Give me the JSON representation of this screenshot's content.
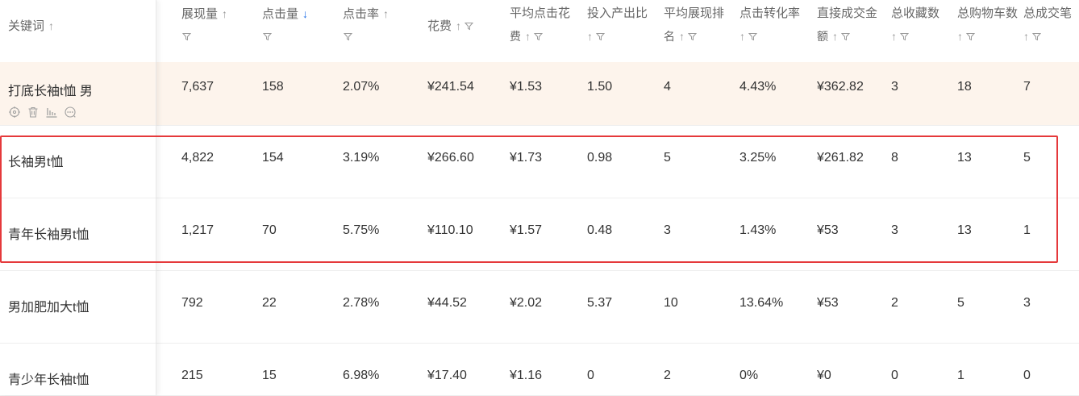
{
  "table": {
    "columns": [
      {
        "key": "keyword",
        "line1": "关键词",
        "line2": "",
        "sort": "↑",
        "filter": false,
        "active": false
      },
      {
        "key": "impressions",
        "line1": "展现量",
        "line2": "",
        "sort": "↑",
        "filter": true,
        "active": false
      },
      {
        "key": "clicks",
        "line1": "点击量",
        "line2": "",
        "sort": "↓",
        "filter": true,
        "active": true
      },
      {
        "key": "ctr",
        "line1": "点击率",
        "line2": "",
        "sort": "↑",
        "filter": true,
        "active": false
      },
      {
        "key": "cost",
        "line1": "花费",
        "line2": "",
        "sort": "↑",
        "filter": true,
        "active": false
      },
      {
        "key": "cpc",
        "line1": "平均点击花",
        "line2": "费",
        "sort": "↑",
        "filter": true,
        "active": false
      },
      {
        "key": "roi",
        "line1": "投入产出比",
        "line2": "",
        "sort": "↑",
        "filter": true,
        "active": false
      },
      {
        "key": "avg_rank",
        "line1": "平均展现排",
        "line2": "名",
        "sort": "↑",
        "filter": true,
        "active": false
      },
      {
        "key": "cvr",
        "line1": "点击转化率",
        "line2": "",
        "sort": "↑",
        "filter": true,
        "active": false
      },
      {
        "key": "gmv",
        "line1": "直接成交金",
        "line2": "额",
        "sort": "↑",
        "filter": true,
        "active": false
      },
      {
        "key": "fav",
        "line1": "总收藏数",
        "line2": "",
        "sort": "↑",
        "filter": true,
        "active": false
      },
      {
        "key": "cart",
        "line1": "总购物车数",
        "line2": "",
        "sort": "↑",
        "filter": true,
        "active": false
      },
      {
        "key": "orders",
        "line1": "总成交笔",
        "line2": "",
        "sort": "↑",
        "filter": true,
        "active": false
      }
    ],
    "rows": [
      {
        "keyword": "打底长袖t恤 男",
        "impressions": "7,637",
        "clicks": "158",
        "ctr": "2.07%",
        "cost": "¥241.54",
        "cpc": "¥1.53",
        "roi": "1.50",
        "avg_rank": "4",
        "cvr": "4.43%",
        "gmv": "¥362.82",
        "fav": "3",
        "cart": "18",
        "orders": "7",
        "highlight": true
      },
      {
        "keyword": "长袖男t恤",
        "impressions": "4,822",
        "clicks": "154",
        "ctr": "3.19%",
        "cost": "¥266.60",
        "cpc": "¥1.73",
        "roi": "0.98",
        "avg_rank": "5",
        "cvr": "3.25%",
        "gmv": "¥261.82",
        "fav": "8",
        "cart": "13",
        "orders": "5",
        "highlight": false
      },
      {
        "keyword": "青年长袖男t恤",
        "impressions": "1,217",
        "clicks": "70",
        "ctr": "5.75%",
        "cost": "¥110.10",
        "cpc": "¥1.57",
        "roi": "0.48",
        "avg_rank": "3",
        "cvr": "1.43%",
        "gmv": "¥53",
        "fav": "3",
        "cart": "13",
        "orders": "1",
        "highlight": false
      },
      {
        "keyword": "男加肥加大t恤",
        "impressions": "792",
        "clicks": "22",
        "ctr": "2.78%",
        "cost": "¥44.52",
        "cpc": "¥2.02",
        "roi": "5.37",
        "avg_rank": "10",
        "cvr": "13.64%",
        "gmv": "¥53",
        "fav": "2",
        "cart": "5",
        "orders": "3",
        "highlight": false
      },
      {
        "keyword": "青少年长袖t恤",
        "impressions": "215",
        "clicks": "15",
        "ctr": "6.98%",
        "cost": "¥17.40",
        "cpc": "¥1.16",
        "roi": "0",
        "avg_rank": "2",
        "cvr": "0%",
        "gmv": "¥0",
        "fav": "0",
        "cart": "1",
        "orders": "0",
        "highlight": false
      }
    ],
    "row_action_icons": [
      "target-icon",
      "trash-icon",
      "bar-chart-icon",
      "more-icon"
    ],
    "colors": {
      "sort_active": "#1f6fe6",
      "highlight_row": "#fdf4ec",
      "selection_box": "#e5393b"
    }
  }
}
